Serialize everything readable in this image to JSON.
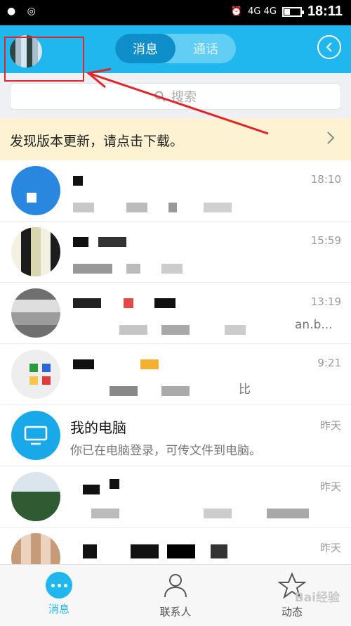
{
  "status_bar": {
    "time": "18:11",
    "network": "4G 4G"
  },
  "header": {
    "tab_messages": "消息",
    "tab_calls": "通话"
  },
  "search": {
    "placeholder": "搜索"
  },
  "banner": {
    "text": "发现版本更新，请点击下载。"
  },
  "conversations": [
    {
      "title": "",
      "preview": "",
      "time": "18:10"
    },
    {
      "title": "",
      "preview": "",
      "time": "15:59"
    },
    {
      "title": "",
      "preview": "an.b...",
      "time": "13:19"
    },
    {
      "title": "",
      "preview": "比",
      "time": "9:21"
    },
    {
      "title": "我的电脑",
      "preview": "你已在电脑登录，可传文件到电脑。",
      "time": "昨天"
    },
    {
      "title": "",
      "preview": "",
      "time": "昨天"
    },
    {
      "title": "",
      "preview": "",
      "time": "昨天"
    }
  ],
  "bottom_nav": {
    "messages": "消息",
    "contacts": "联系人",
    "dynamic": "动态"
  },
  "watermark": "Bai经验",
  "colors": {
    "accent": "#1fb7ee",
    "banner": "#fdf3d3",
    "annotation": "#e0262a"
  }
}
